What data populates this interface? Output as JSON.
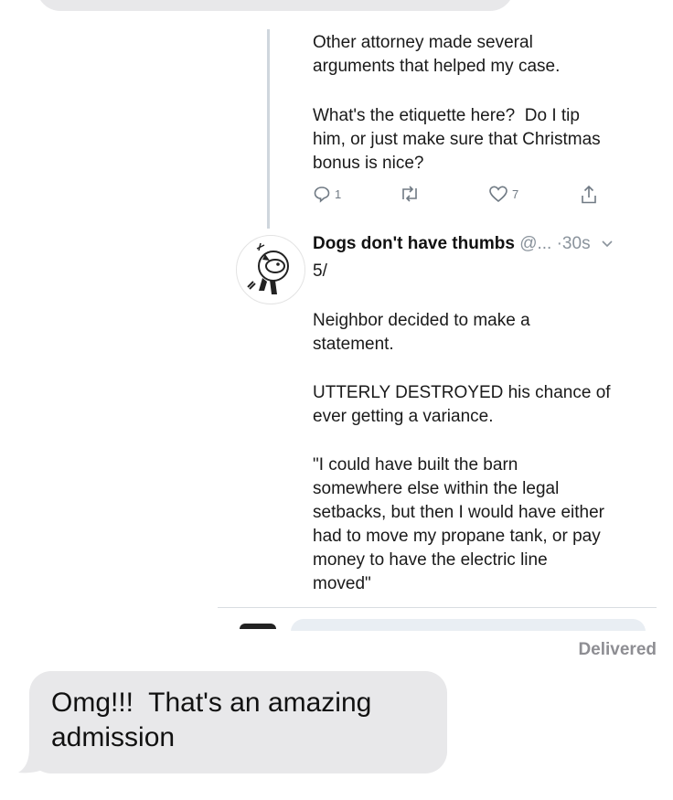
{
  "tweet_1": {
    "text_1": "Other attorney made several\narguments that helped my case.",
    "text_2": "What's the etiquette here?  Do I tip\nhim, or just make sure that Christmas\nbonus is nice?",
    "reply_count": "1",
    "like_count": "7"
  },
  "tweet_2": {
    "name": "Dogs don't have thumbs",
    "handle": "@...",
    "time": "·30s",
    "text_1": "5/",
    "text_2": "Neighbor decided to make a\nstatement.",
    "text_3": "UTTERLY DESTROYED his chance of\never getting a variance.",
    "text_4": "\"I could have built the barn\nsomewhere else within the legal\nsetbacks, but then I would have either\nhad to move my propane tank, or pay\nmoney to have the electric line\nmoved\""
  },
  "status": {
    "delivered": "Delivered"
  },
  "message": {
    "text": "Omg!!!  That's an amazing\nadmission"
  },
  "colors": {
    "bubble": "#e8e8ea",
    "muted": "#8e8e93",
    "icon": "#707a84"
  }
}
